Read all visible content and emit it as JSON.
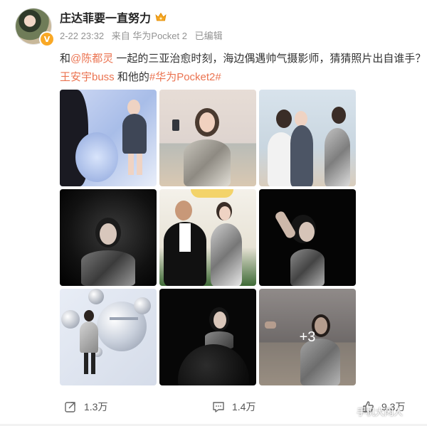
{
  "user": {
    "name": "庄达菲要一直努力",
    "badge_icon": "crown-icon",
    "verified_icon": "verified-v-icon"
  },
  "meta": {
    "time": "2-22 23:32",
    "source": "来自 华为Pocket 2",
    "edited": "已编辑"
  },
  "post": {
    "text_prefix": "和",
    "mention": "@陈都灵",
    "text_middle": " 一起的三亚治愈时刻，海边偶遇帅气摄影师，猜猜照片出自谁手？",
    "photographer_link": "王安宇buss",
    "text_connector": " 和他的",
    "hashtag": "#华为Pocket2#"
  },
  "photos": {
    "more_label": "+3"
  },
  "actions": {
    "repost_count": "1.3万",
    "comment_count": "1.4万",
    "like_count": "9.3万"
  },
  "watermark": {
    "text": "手机大闲人"
  },
  "colors": {
    "link": "#eb7350",
    "meta": "#939393",
    "badge": "#f9a825"
  }
}
